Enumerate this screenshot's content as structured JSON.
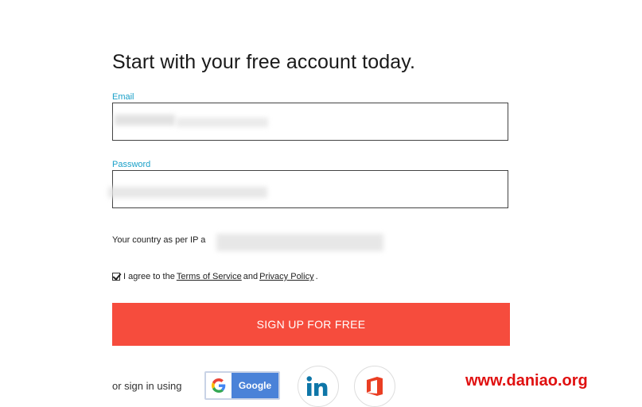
{
  "title": "Start with your free account today.",
  "email": {
    "label": "Email"
  },
  "password": {
    "label": "Password"
  },
  "country": {
    "text": "Your country as per IP a"
  },
  "agree": {
    "prefix": "I agree to the",
    "terms": "Terms of Service",
    "and": "and",
    "privacy": "Privacy Policy",
    "suffix": "."
  },
  "signup_label": "SIGN UP FOR FREE",
  "social": {
    "or_text": "or sign in using",
    "google_label": "Google"
  },
  "watermark": "www.daniao.org",
  "colors": {
    "accent": "#f64c3d",
    "label": "#1aa0c8",
    "google": "#4a82d8",
    "linkedin": "#0e76a8",
    "office": "#ea3e23"
  }
}
